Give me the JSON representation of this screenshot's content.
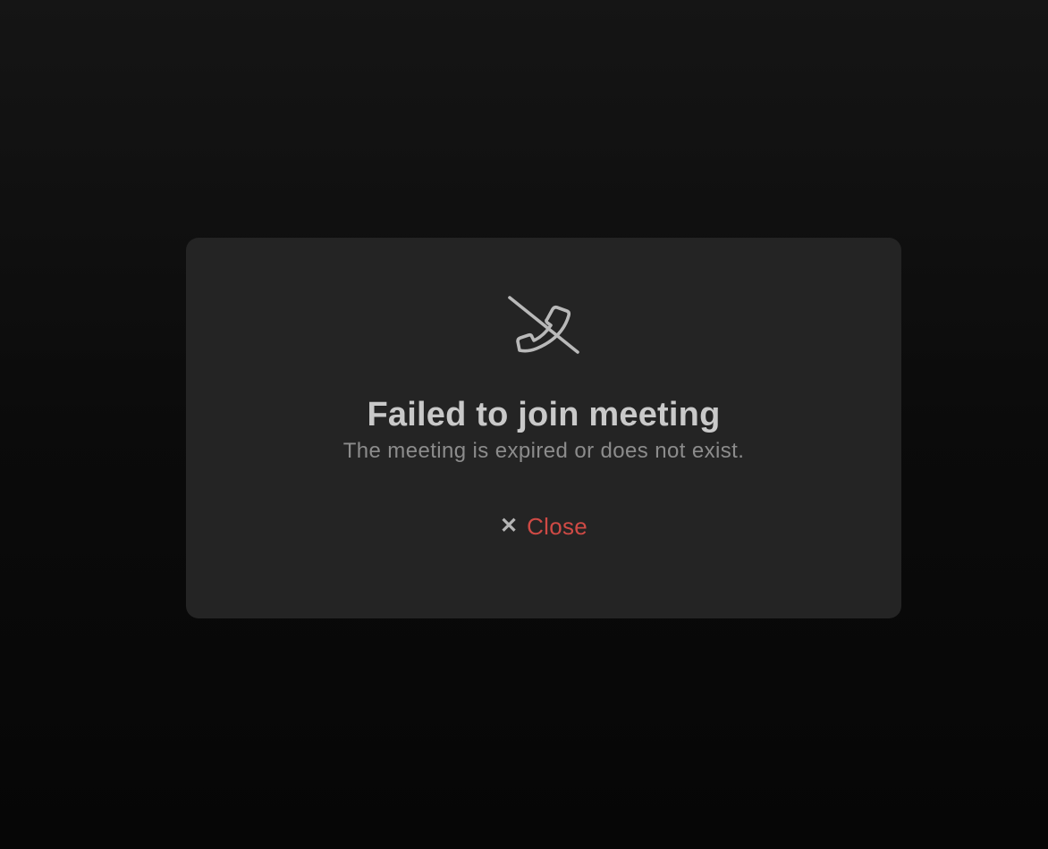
{
  "dialog": {
    "icon": "phone-off-icon",
    "title": "Failed to join meeting",
    "message": "The meeting is expired or does not exist.",
    "close_icon": "close-icon",
    "close_label": "Close"
  },
  "colors": {
    "background": "#0b0b0b",
    "dialog_bg": "#242424",
    "title": "#c9c9c9",
    "message": "#8c8c8c",
    "close_accent": "#cf4a45"
  }
}
